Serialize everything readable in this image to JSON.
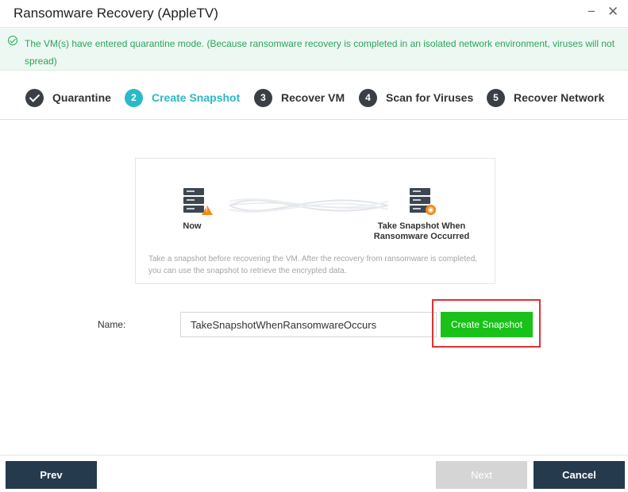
{
  "window": {
    "title": "Ransomware Recovery (AppleTV)",
    "minimize_symbol": "−",
    "close_symbol": "✕"
  },
  "notice": {
    "icon": "check-circle-icon",
    "text": "The VM(s) have entered quarantine mode. (Because ransomware recovery is completed in an isolated network environment, viruses will not spread)"
  },
  "steps": [
    {
      "number": "",
      "label": "Quarantine",
      "state": "done"
    },
    {
      "number": "2",
      "label": "Create Snapshot",
      "state": "active"
    },
    {
      "number": "3",
      "label": "Recover VM",
      "state": "pending"
    },
    {
      "number": "4",
      "label": "Scan for Viruses",
      "state": "pending"
    },
    {
      "number": "5",
      "label": "Recover Network",
      "state": "pending"
    }
  ],
  "illustration": {
    "left_label": "Now",
    "right_label_line1": "Take Snapshot When",
    "right_label_line2": "Ransomware Occurred",
    "description": "Take a snapshot before recovering the VM. After the recovery from ransomware is completed, you can use the snapshot to retrieve the encrypted data."
  },
  "form": {
    "name_label": "Name:",
    "name_value": "TakeSnapshotWhenRansomwareOccurs",
    "create_button": "Create Snapshot"
  },
  "footer": {
    "prev": "Prev",
    "next": "Next",
    "cancel": "Cancel"
  },
  "colors": {
    "accent": "#2bb9c6",
    "success": "#2aa55a",
    "create_button": "#19c119",
    "primary_dark": "#263a4e",
    "highlight": "#e03131",
    "warning": "#f08a1c"
  }
}
